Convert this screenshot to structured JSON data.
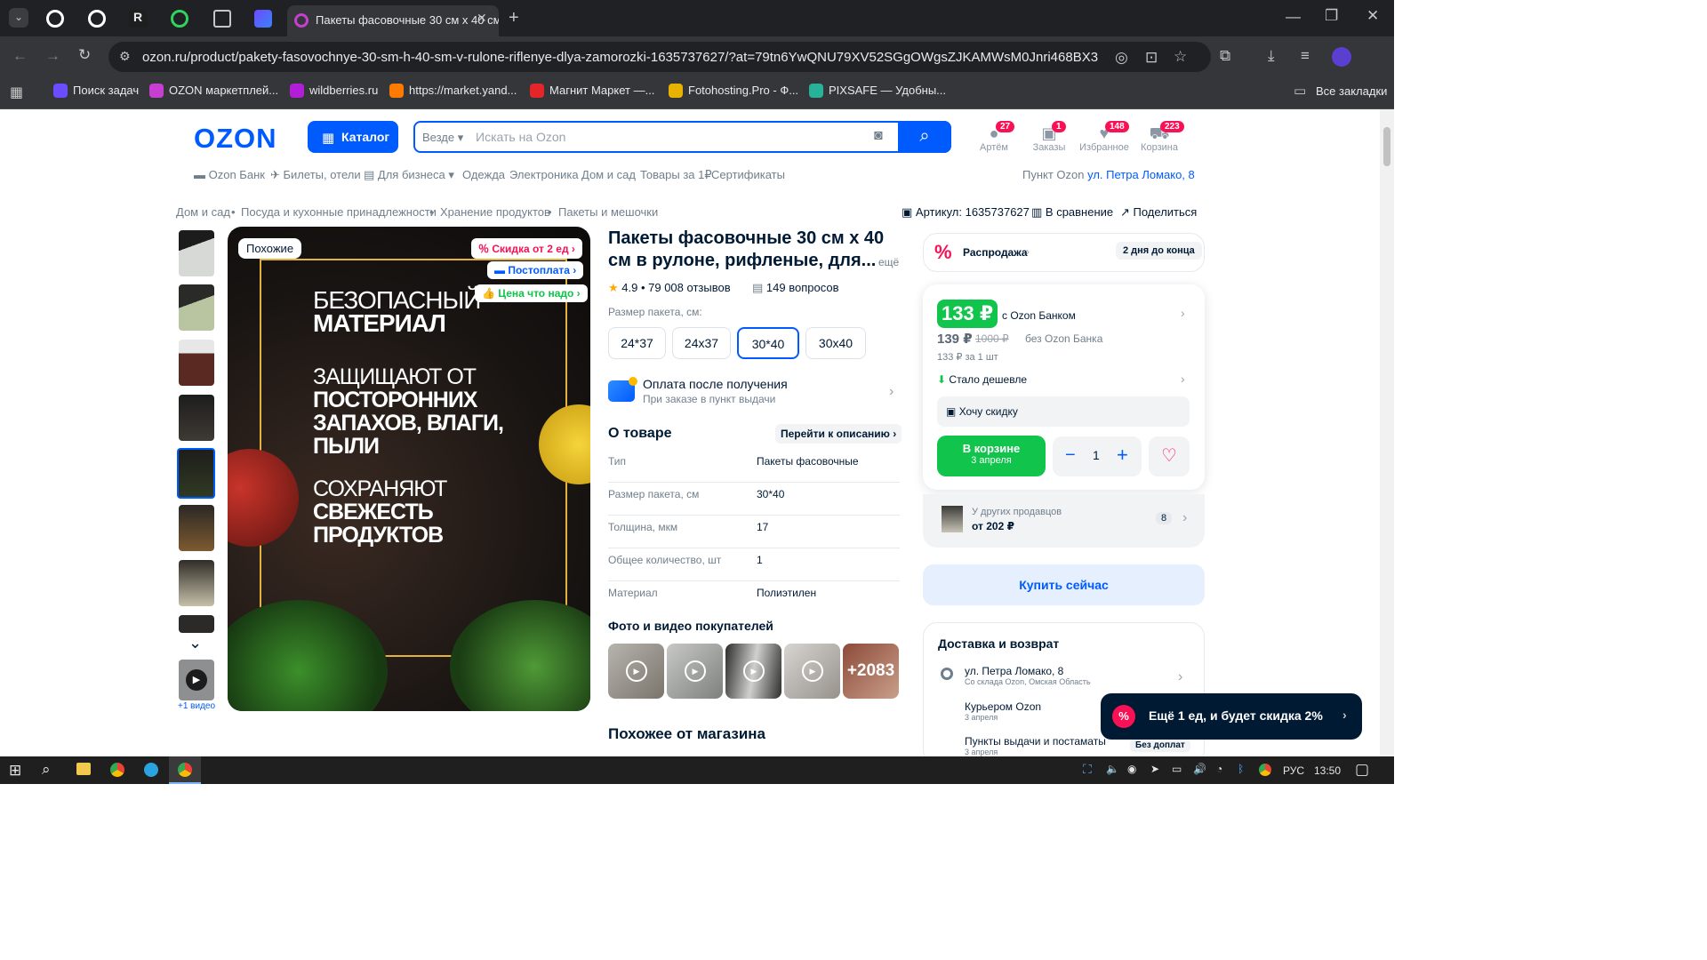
{
  "browser": {
    "active_tab_title": "Пакеты фасовочные 30 см х 40 см",
    "new_tab": "+",
    "url": "ozon.ru/product/pakety-fasovochnye-30-sm-h-40-sm-v-rulone-riflenye-dlya-zamorozki-1635737627/?at=79tn6YwQNU79XV52SGgOWgsZJKAMWsM0Jnri468BX3",
    "bookmarks": [
      {
        "label": "Поиск задач",
        "color": "#6b4cff"
      },
      {
        "label": "OZON маркетплей...",
        "color": "#c63fd1"
      },
      {
        "label": "wildberries.ru",
        "color": "#b21dd8"
      },
      {
        "label": "https://market.yand...",
        "color": "#ff7a00"
      },
      {
        "label": "Магнит Маркет —...",
        "color": "#e4262a"
      },
      {
        "label": "Fotohosting.Pro - Ф...",
        "color": "#e8b200"
      },
      {
        "label": "PIXSAFE — Удобны...",
        "color": "#27b39a"
      }
    ],
    "all_bookmarks": "Все закладки"
  },
  "header": {
    "logo": "OZON",
    "catalog": "Каталог",
    "search_scope": "Везде",
    "search_placeholder": "Искать на Ozon",
    "icons": [
      {
        "label": "Артём",
        "badge": "27"
      },
      {
        "label": "Заказы",
        "badge": "1"
      },
      {
        "label": "Избранное",
        "badge": "148"
      },
      {
        "label": "Корзина",
        "badge": "223"
      }
    ],
    "nav": [
      "Ozon Банк",
      "Билеты, отели",
      "Для бизнеса",
      "Одежда",
      "Электроника",
      "Дом и сад",
      "Товары за 1₽",
      "Сертификаты"
    ],
    "pickup_label": "Пункт Ozon",
    "pickup_address": "ул. Петра Ломако, 8"
  },
  "breadcrumbs": [
    "Дом и сад",
    "Посуда и кухонные принадлежности",
    "Хранение продуктов",
    "Пакеты и мешочки"
  ],
  "actions": {
    "article": "Артикул: 1635737627",
    "compare": "В сравнение",
    "share": "Поделиться"
  },
  "gallery": {
    "similar": "Похожие",
    "chips": [
      {
        "text": "Скидка от 2 ед",
        "color": "#f91155"
      },
      {
        "text": "Постоплата",
        "color": "#005bff"
      },
      {
        "text": "Цена что надо",
        "color": "#10c44c"
      }
    ],
    "lines_light": [
      "БЕЗОПАСНЫЙ",
      "ЗАЩИЩАЮТ ОТ",
      "СОХРАНЯЮТ"
    ],
    "lines_bold": [
      "МАТЕРИАЛ",
      "ПОСТОРОННИХ",
      "ЗАПАХОВ, ВЛАГИ,",
      "ПЫЛИ",
      "СВЕЖЕСТЬ",
      "ПРОДУКТОВ"
    ],
    "video_caption": "+1 видео"
  },
  "product": {
    "title": "Пакеты фасовочные 30 см х 40 см в рулоне, рифленые, для...",
    "more": "ещё",
    "rating": "4.9 • 79 008 отзывов",
    "questions": "149 вопросов",
    "size_label": "Размер пакета, см:",
    "sizes": [
      "24*37",
      "24х37",
      "30*40",
      "30х40"
    ],
    "selected_size": "30*40",
    "payment_title": "Оплата после получения",
    "payment_sub": "При заказе в пункт выдачи",
    "about": "О товаре",
    "goto_desc": "Перейти к описанию",
    "specs": [
      {
        "k": "Тип",
        "v": "Пакеты фасовочные"
      },
      {
        "k": "Размер пакета, см",
        "v": "30*40"
      },
      {
        "k": "Толщина, мкм",
        "v": "17"
      },
      {
        "k": "Общее количество, шт",
        "v": "1"
      },
      {
        "k": "Материал",
        "v": "Полиэтилен"
      }
    ],
    "buyer_media": "Фото и видео покупателей",
    "media_more": "+2083",
    "similar_store": "Похожее от магазина"
  },
  "buy": {
    "sale": "Распродажа",
    "sale_days": "2 дня до конца",
    "price_bank": "133 ₽",
    "with_bank": "с Ozon Банком",
    "price": "139 ₽",
    "price_old": "1000 ₽",
    "without_bank": "без Ozon Банка",
    "per_unit": "133 ₽ за 1 шт",
    "cheaper": "Стало дешевле",
    "want_discount": "Хочу скидку",
    "in_cart": "В корзине",
    "in_cart_date": "3 апреля",
    "qty": "1",
    "other_sellers": "У других продавцов",
    "other_from": "от 202 ₽",
    "other_count": "8",
    "buy_now": "Купить сейчас",
    "delivery_title": "Доставка и возврат",
    "delivery": [
      {
        "title": "ул. Петра Ломако, 8",
        "sub": "Со склада Ozon, Омская Область"
      },
      {
        "title": "Курьером Ozon",
        "sub": "3 апреля"
      },
      {
        "title": "Пункты выдачи и постаматы",
        "sub": "3 апреля",
        "tag": "Без доплат"
      }
    ],
    "toast": "Ещё 1 ед, и будет скидка 2%"
  },
  "taskbar": {
    "lang": "РУС",
    "time": "13:50"
  }
}
